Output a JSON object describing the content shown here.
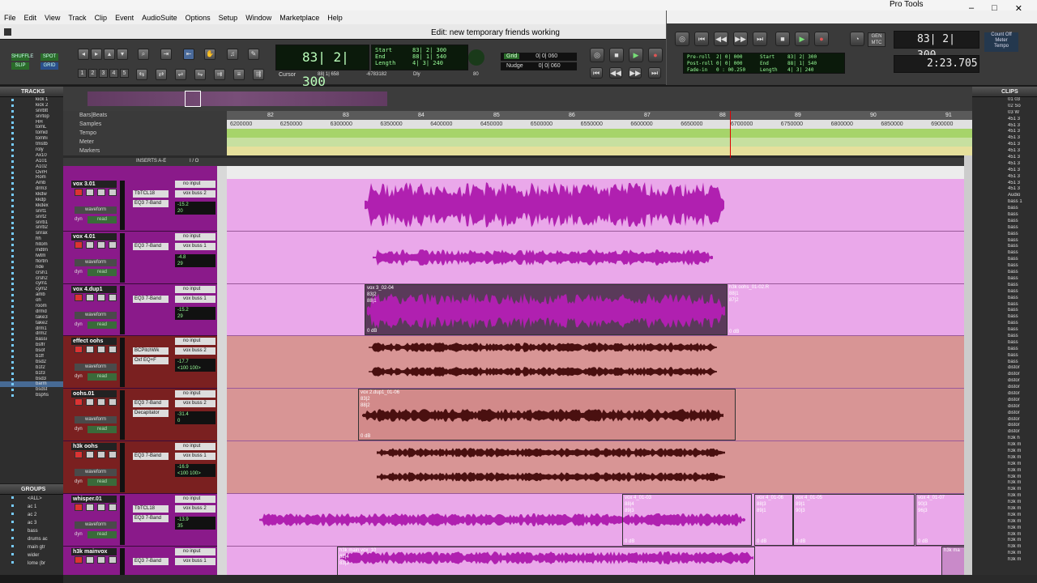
{
  "app": {
    "name": "Pro Tools",
    "window_title": "Edit: new temporary friends working",
    "menu": [
      "File",
      "Edit",
      "View",
      "Track",
      "Clip",
      "Event",
      "AudioSuite",
      "Options",
      "Setup",
      "Window",
      "Marketplace",
      "Help"
    ]
  },
  "edit_modes": {
    "shuffle": "SHUFFLE",
    "spot": "SPOT",
    "slip": "SLIP",
    "grid": "GRID"
  },
  "zoom_presets": [
    "1",
    "2",
    "3",
    "4",
    "5"
  ],
  "counters": {
    "main": "83| 2| 300",
    "start": "83| 2| 300",
    "end": "88| 1| 540",
    "length": "4| 3| 240",
    "start_label": "Start",
    "end_label": "End",
    "length_label": "Length",
    "cursor_label": "Cursor",
    "cursor_value": "88| 1| 658",
    "sample_value": "-6783182",
    "grid_label": "Grid",
    "grid_value": "0| 0| 060",
    "nudge_label": "Nudge",
    "nudge_value": "0| 0| 060",
    "dly_label": "Dly",
    "dly_value": "80"
  },
  "transport": {
    "preroll_label": "Pre-roll",
    "preroll": "2| 0| 000",
    "postroll_label": "Post-roll",
    "postroll": "0| 0| 000",
    "fadein_label": "Fade-in",
    "fadein": "0 : 00.250",
    "start": "83| 2| 300",
    "end": "88| 1| 540",
    "length": "4| 3| 240",
    "main_counter": "83| 2| 300",
    "sub_counter": "2:23.705",
    "gen_mtc": "GEN MTC",
    "count_off": "Count Off",
    "meter_label": "Meter",
    "tempo_label": "Tempo"
  },
  "panels": {
    "tracks_title": "TRACKS",
    "groups_title": "GROUPS",
    "clips_title": "CLIPS"
  },
  "tracks_list": [
    "kick 1",
    "kick 2",
    "snrbtt",
    "snrtop",
    "HH",
    "tomL",
    "tomid",
    "tomhi",
    "tmstb",
    "roly",
    "Ax10",
    "A101",
    "A102",
    "OvrH",
    "Rom",
    "Amb",
    "drm3",
    "kkdw",
    "kkdp",
    "kkdex",
    "snrt1",
    "snrt2",
    "snrb1",
    "snrb2",
    "snrax",
    "hh",
    "hitom",
    "mdtm",
    "lwtm",
    "flortm",
    "ride",
    "crsh1",
    "crsh2",
    "cym1",
    "cym2",
    "amb",
    "oh",
    "room",
    "drmd",
    "take3",
    "take2",
    "drm1",
    "drm2",
    "bassi",
    "bsffr",
    "bsof",
    "b1ff",
    "bsd2",
    "b1f2",
    "b1f3",
    "bsd3",
    "barm",
    "bsdst",
    "bsphs"
  ],
  "groups_list": [
    "<ALL>",
    "ac 1",
    "ac 2",
    "ac 3",
    "bass",
    "drums ac",
    "main gtr",
    "wider",
    "lome (br"
  ],
  "clips_list": [
    "01 03",
    "02 So",
    "03 W",
    "451 3",
    "451 3",
    "451 3",
    "451 3",
    "451 3",
    "451 3",
    "451 3",
    "451 3",
    "451 3",
    "451 3",
    "451 3",
    "451 3",
    "Audio",
    "bass 1",
    "bass",
    "bass",
    "bass",
    "bass",
    "bass",
    "bass",
    "bass",
    "bass",
    "bass",
    "bass",
    "bass",
    "bass",
    "bass",
    "bass",
    "bass",
    "bass",
    "bass",
    "bass",
    "bass",
    "bass",
    "bass",
    "bass",
    "bass",
    "bass",
    "bass",
    "distor",
    "distor",
    "distor",
    "distor",
    "distor",
    "distor",
    "distor",
    "distor",
    "distor",
    "distor",
    "distor",
    "h3k h",
    "h3k m",
    "h3k m",
    "h3k m",
    "h3k m",
    "h3k m",
    "h3k m",
    "h3k m",
    "h3k m",
    "h3k m",
    "h3k m",
    "h3k m",
    "h3k m",
    "h3k m",
    "h3k m",
    "h3k m",
    "h3k m",
    "h3k m",
    "h3k m",
    "h3k m"
  ],
  "rulers": {
    "bars_beats": "Bars|Beats",
    "samples": "Samples",
    "tempo": "Tempo",
    "meter": "Meter",
    "markers": "Markers",
    "bar_ticks": [
      "82",
      "83",
      "84",
      "85",
      "86",
      "87",
      "88",
      "89",
      "90",
      "91"
    ],
    "sample_ticks": [
      "6200000",
      "6250000",
      "6300000",
      "6350000",
      "6400000",
      "6450000",
      "6500000",
      "6550000",
      "6600000",
      "6650000",
      "6700000",
      "6750000",
      "6800000",
      "6850000",
      "6900000"
    ]
  },
  "mixer_header": {
    "inserts": "INSERTS A-E",
    "io": "I / O"
  },
  "tracks": [
    {
      "name": "vox 3.01",
      "plugins": [
        "TbTCL18",
        "EQ3 7-Band"
      ],
      "input": "no input",
      "output": "vox buss 2",
      "vol": "-15.2",
      "pan": "20",
      "view": "waveform",
      "mode": "read",
      "dyn": "dyn",
      "color": "pink"
    },
    {
      "name": "vox 4.01",
      "plugins": [
        "EQ3 7-Band"
      ],
      "input": "no input",
      "output": "vox buss 1",
      "vol": "-4.8",
      "pan": "29",
      "view": "waveform",
      "mode": "read",
      "dyn": "dyn",
      "color": "pink"
    },
    {
      "name": "vox 4.dup1",
      "plugins": [
        "EQ3 7-Band"
      ],
      "input": "no input",
      "output": "vox buss 1",
      "vol": "-15.2",
      "pan": "29",
      "view": "waveform",
      "mode": "read",
      "dyn": "dyn",
      "color": "pink"
    },
    {
      "name": "effect oohs",
      "plugins": [
        "BCPitchWk",
        "Oxf EQ+F"
      ],
      "input": "no input",
      "output": "vox buss 2",
      "vol": "-17.7",
      "pan": "<100 100>",
      "view": "waveform",
      "mode": "read",
      "dyn": "dyn",
      "color": "salmon"
    },
    {
      "name": "oohs.01",
      "plugins": [
        "EQ3 7-Band",
        "Decapitator"
      ],
      "input": "no input",
      "output": "vox buss 2",
      "vol": "-31.4",
      "pan": "0",
      "view": "waveform",
      "mode": "read",
      "dyn": "dyn",
      "color": "salmon"
    },
    {
      "name": "h3k oohs",
      "plugins": [
        "EQ3 7-Band"
      ],
      "input": "no input",
      "output": "vox buss 1",
      "vol": "-16.9",
      "pan": "<100 100>",
      "view": "waveform",
      "mode": "read",
      "dyn": "dyn",
      "color": "salmon"
    },
    {
      "name": "whisper.01",
      "plugins": [
        "TbTCL18",
        "EQ3 7-Band"
      ],
      "input": "no input",
      "output": "vox buss 2",
      "vol": "-13.9",
      "pan": "35",
      "view": "waveform",
      "mode": "read",
      "dyn": "dyn",
      "color": "pink"
    },
    {
      "name": "h3k mainvox",
      "plugins": [
        "EQ3 7-Band"
      ],
      "input": "no input",
      "output": "vox buss 1",
      "vol": "",
      "pan": "",
      "view": "",
      "mode": "",
      "dyn": "",
      "color": "pink"
    }
  ],
  "regions": [
    {
      "name": "vox 3_02-04",
      "pos1": "83|2",
      "pos2": "88|1",
      "gain": "0 dB"
    },
    {
      "name": "h3k oohs_01-02.R",
      "pos1": "88|1",
      "pos2": "87|2",
      "gain": "0 dB"
    },
    {
      "name": "vox 2.dup1_01-06",
      "pos1": "83|2",
      "pos2": "88|2",
      "gain": "0 dB"
    },
    {
      "name": "vox 4_01-03",
      "pos1": "88|4",
      "pos2": "89|3",
      "gain": "0 dB"
    },
    {
      "name": "vox 4_01-06",
      "pos1": "88|3",
      "pos2": "89|1",
      "gain": "0 dB"
    },
    {
      "name": "vox 4_01-05",
      "pos1": "89|1",
      "pos2": "90|3",
      "gain": "0 dB"
    },
    {
      "name": "vox 4_01-07",
      "pos1": "90|3",
      "pos2": "96|3",
      "gain": "0 dB"
    },
    {
      "name": "h3k main vox_10",
      "pos1": "82|4",
      "pos2": "83|3",
      "gain": ""
    },
    {
      "name": "h3k ma",
      "pos1": "",
      "pos2": "",
      "gain": ""
    }
  ],
  "colors": {
    "pink_track": "#eaa8ea",
    "salmon_track": "#d89595",
    "track_header": "#8a1a8a",
    "counter_text": "#99ff99",
    "playhead": "#dd0000"
  }
}
